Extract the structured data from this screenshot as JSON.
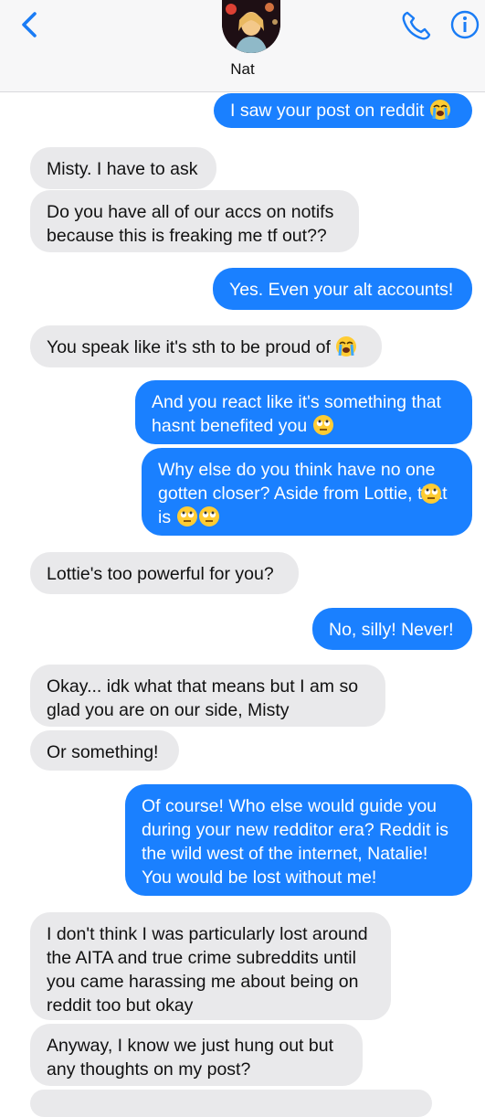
{
  "header": {
    "contact_name": "Nat"
  },
  "messages": [
    {
      "from": "me",
      "text": "I saw your post on reddit",
      "emoji": [
        "sob"
      ]
    },
    {
      "from": "them",
      "text": "Misty. I have to ask"
    },
    {
      "from": "them",
      "text": "Do you have all of our accs on notifs because this is freaking me tf out??"
    },
    {
      "from": "me",
      "text": "Yes. Even your alt accounts!"
    },
    {
      "from": "them",
      "text": "You speak like it's sth to be proud of",
      "emoji": [
        "sob"
      ]
    },
    {
      "from": "me",
      "text": "And you react like it's something that hasnt benefited you",
      "emoji": [
        "eye-roll"
      ]
    },
    {
      "from": "me",
      "text": "Why else do you think have no one gotten closer? Aside from Lottie, that is",
      "emoji": [
        "eye-roll",
        "eye-roll",
        "eye-roll"
      ]
    },
    {
      "from": "them",
      "text": "Lottie's too powerful for you?"
    },
    {
      "from": "me",
      "text": "No, silly! Never!"
    },
    {
      "from": "them",
      "text": "Okay... idk what that means but I am so glad you are on our side, Misty"
    },
    {
      "from": "them",
      "text": "Or something!"
    },
    {
      "from": "me",
      "text": "Of course! Who else would guide you during your new redditor era? Reddit is the wild west of the internet, Natalie! You would be lost without me!"
    },
    {
      "from": "them",
      "text": "I don't think I was particularly lost around the AITA and true crime subreddits until you came harassing me about being on reddit too but okay"
    },
    {
      "from": "them",
      "text": "Anyway, I know we just hung out but any thoughts on my post?"
    }
  ],
  "colors": {
    "outgoing": "#1a80ff",
    "incoming": "#e9e9eb",
    "accent": "#1a7cf5"
  }
}
